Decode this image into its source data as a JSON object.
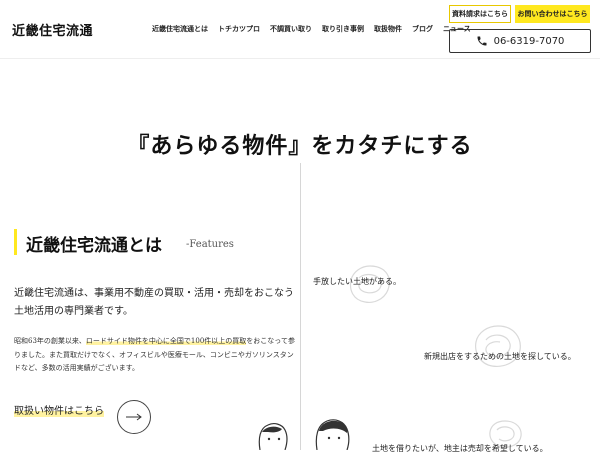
{
  "header": {
    "logo": "近畿住宅流通",
    "nav": [
      "近畿住宅流通とは",
      "トチカツプロ",
      "不調買い取り",
      "取り引き事例",
      "取扱物件",
      "ブログ",
      "ニュース"
    ],
    "doc_button": "資料請求はこちら",
    "contact_button": "お問い合わせはこちら",
    "phone": "06-6319-7070"
  },
  "hero": {
    "title": "『あらゆる物件』をカタチにする"
  },
  "section": {
    "title": "近畿住宅流通とは",
    "subtitle": "-Features",
    "lead": "近畿住宅流通は、事業用不動産の買取・活用・売却をおこなう土地活用の専門業者です。",
    "body_pre": "昭和63年の創業以来、",
    "body_highlight": "ロードサイド物件を中心に全国で100件以上の買取",
    "body_post": "をおこなって参りました。また買取だけでなく、オフィスビルや医療モール、コンビニやガソリンスタンドなど、多数の活用実績がございます。",
    "link_text": "取扱い物件はこちら"
  },
  "right": {
    "text1": "手放したい土地がある。",
    "text2": "新規出店をするための土地を探している。",
    "text3": "土地を借りたいが、地主は売却を希望している。"
  }
}
